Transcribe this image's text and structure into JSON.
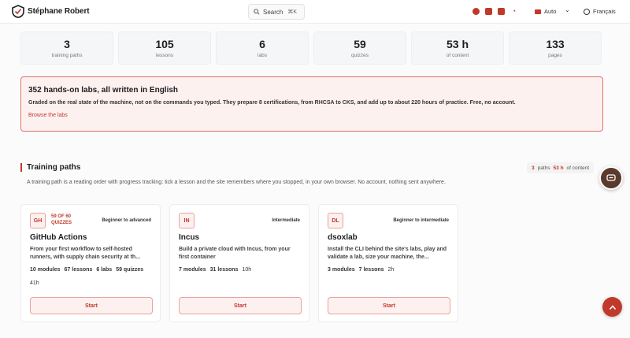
{
  "header": {
    "brand": "Stéphane Robert",
    "search_label": "Search",
    "search_shortcut": "⌘K",
    "icons": [
      "github-icon",
      "linkedin-icon",
      "discord-icon",
      "rss-icon"
    ],
    "theme_label": "Auto",
    "language_label": "Français"
  },
  "stats": [
    {
      "value": "3",
      "label": "training paths"
    },
    {
      "value": "105",
      "label": "lessons"
    },
    {
      "value": "6",
      "label": "labs"
    },
    {
      "value": "59",
      "label": "quizzes"
    },
    {
      "value": "53 h",
      "label": "of content"
    },
    {
      "value": "133",
      "label": "pages"
    }
  ],
  "banner": {
    "title": "352 hands-on labs, all written in English",
    "text": "Graded on the real state of the machine, not on the commands you typed. They prepare 8 certifications, from RHCSA to CKS, and add up to about 220 hours of practice. Free, no account.",
    "link": "Browse the labs"
  },
  "training": {
    "title": "Training paths",
    "count_paths": "3",
    "paths_word": "paths",
    "count_hours": "53 h",
    "hours_word": "of content",
    "description": "A training path is a reading order with progress tracking: tick a lesson and the site remembers where you stopped, in your own browser. No account, nothing sent anywhere.",
    "cards": [
      {
        "badge": "GH",
        "quiz_note": "59 OF 60 QUIZZES",
        "level": "Beginner to advanced",
        "title": "GitHub Actions",
        "description": "From your first workflow to self-hosted runners, with supply chain security at th...",
        "modules": "10 modules",
        "lessons": "67 lessons",
        "labs": "6 labs",
        "quizzes": "59 quizzes",
        "duration": "41h",
        "button": "Start"
      },
      {
        "badge": "IN",
        "quiz_note": "",
        "level": "Intermediate",
        "title": "Incus",
        "description": "Build a private cloud with Incus, from your first container",
        "modules": "7 modules",
        "lessons": "31 lessons",
        "labs": "",
        "quizzes": "",
        "duration": "10h",
        "button": "Start"
      },
      {
        "badge": "DL",
        "quiz_note": "",
        "level": "Beginner to intermediate",
        "title": "dsoxlab",
        "description": "Install the CLI behind the site's labs, play and validate a lab, size your machine, the...",
        "modules": "3 modules",
        "lessons": "7 lessons",
        "labs": "",
        "quizzes": "",
        "duration": "2h",
        "button": "Start"
      }
    ]
  },
  "colors": {
    "accent": "#c0392b",
    "banner_bg": "#fdf1f0",
    "fab_dark": "#5b3a2e"
  }
}
